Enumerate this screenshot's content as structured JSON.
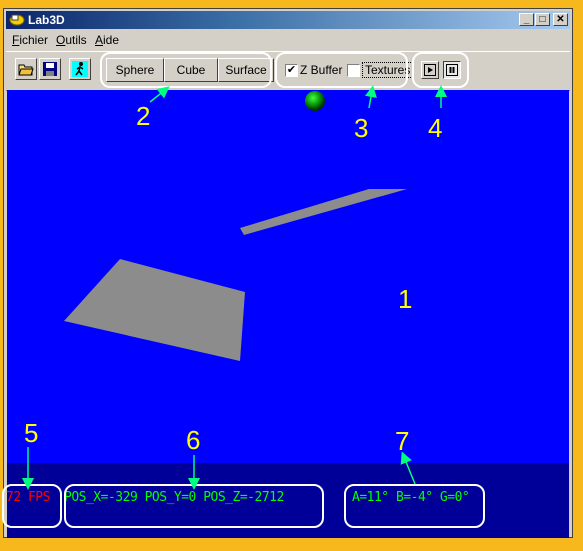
{
  "window": {
    "title": "Lab3D"
  },
  "menu": [
    {
      "label": "Fichier"
    },
    {
      "label": "Outils"
    },
    {
      "label": "Aide"
    }
  ],
  "toolbar": {
    "buttons": [
      {
        "label": "Sphere"
      },
      {
        "label": "Cube"
      },
      {
        "label": "Surface"
      }
    ],
    "zbuffer": {
      "label": "Z Buffer",
      "checked": true
    },
    "textures": {
      "label": "Textures",
      "checked": false
    }
  },
  "hud": {
    "fps": "72 FPS",
    "position": "POS_X=-329 POS_Y=0 POS_Z=-2712",
    "angles": "A=11° B=-4° G=0°"
  },
  "annotations": [
    "1",
    "2",
    "3",
    "4",
    "5",
    "6",
    "7"
  ],
  "colors": {
    "viewport": "#0000ff",
    "status_bar": "#000098",
    "fps": "#ff0000",
    "hud_text": "#00ff00",
    "annotation": "#ffff00",
    "arrow": "#00ff80",
    "background": "#f7b81e"
  }
}
